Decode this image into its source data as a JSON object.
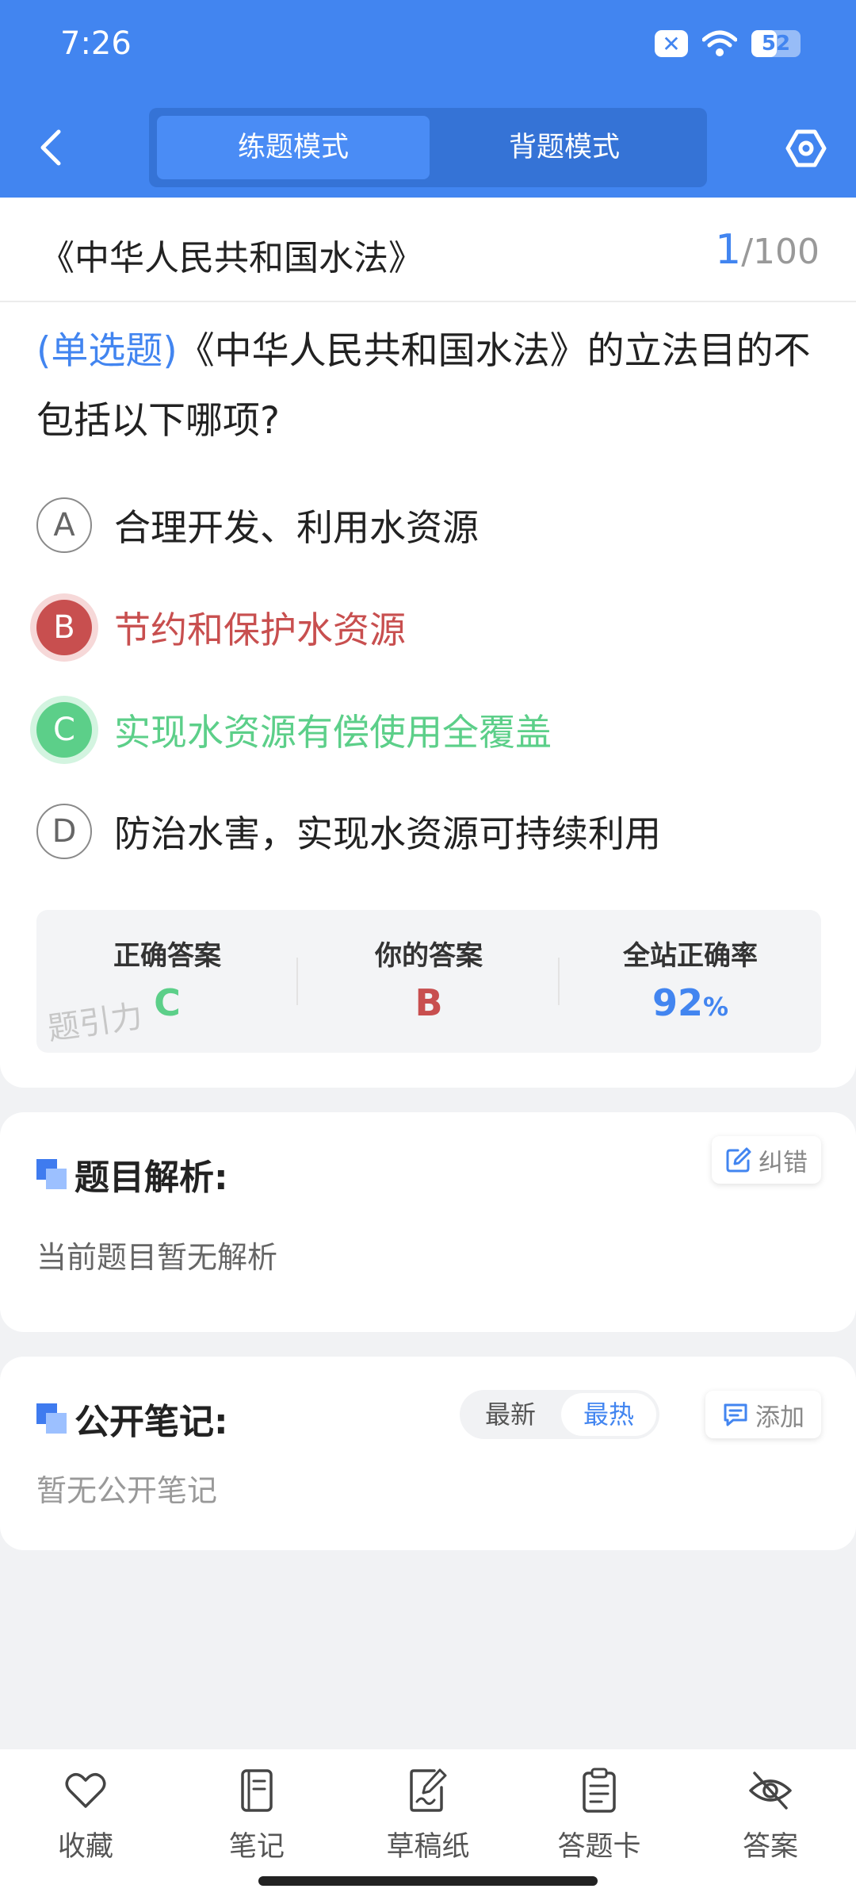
{
  "status_bar": {
    "time": "7:26",
    "battery": "52",
    "battery_level": 0.52
  },
  "header": {
    "mode_tabs": [
      {
        "label": "练题模式",
        "active": true
      },
      {
        "label": "背题模式",
        "active": false
      }
    ]
  },
  "question": {
    "law_title": "《中华人民共和国水法》",
    "current": "1",
    "total": "/100",
    "type": "(单选题)",
    "text": "《中华人民共和国水法》的立法目的不包括以下哪项?",
    "options": [
      {
        "letter": "A",
        "text": "合理开发、利用水资源",
        "state": "normal"
      },
      {
        "letter": "B",
        "text": "节约和保护水资源",
        "state": "wrong"
      },
      {
        "letter": "C",
        "text": "实现水资源有偿使用全覆盖",
        "state": "correct"
      },
      {
        "letter": "D",
        "text": "防治水害，实现水资源可持续利用",
        "state": "normal"
      }
    ]
  },
  "answer_summary": {
    "correct_label": "正确答案",
    "correct_value": "C",
    "yours_label": "你的答案",
    "yours_value": "B",
    "rate_label": "全站正确率",
    "rate_value": "92",
    "rate_unit": "%",
    "watermark": "题引力"
  },
  "analysis": {
    "title": "题目解析:",
    "correction_button": "纠错",
    "body": "当前题目暂无解析"
  },
  "notes": {
    "title": "公开笔记:",
    "sort_latest": "最新",
    "sort_hot": "最热",
    "add_button": "添加",
    "body": "暂无公开笔记"
  },
  "bottom_nav": {
    "items": [
      {
        "label": "收藏",
        "icon": "heart-icon"
      },
      {
        "label": "笔记",
        "icon": "notebook-icon"
      },
      {
        "label": "草稿纸",
        "icon": "draft-paper-icon"
      },
      {
        "label": "答题卡",
        "icon": "answer-sheet-icon"
      },
      {
        "label": "答案",
        "icon": "eye-off-icon"
      }
    ]
  },
  "colors": {
    "primary": "#4285f0",
    "wrong": "#c84f4f",
    "correct": "#5ccf89",
    "background": "#f1f2f4"
  }
}
